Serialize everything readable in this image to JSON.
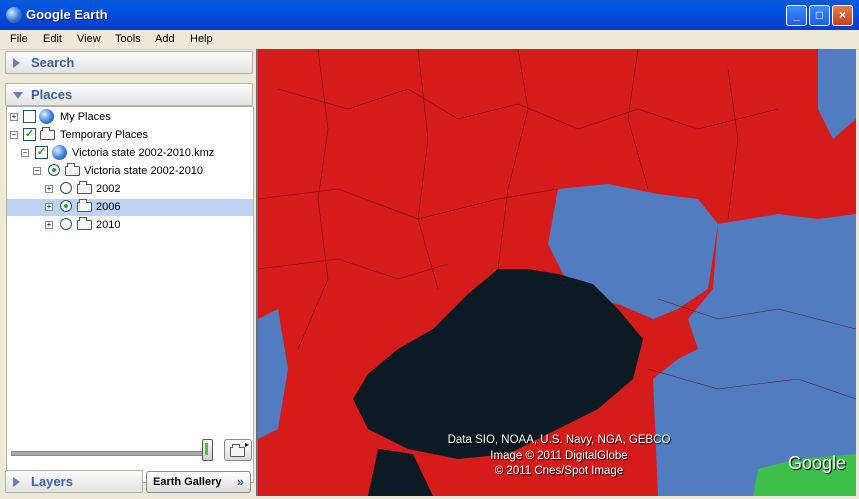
{
  "window": {
    "title": "Google Earth"
  },
  "menu": [
    "File",
    "Edit",
    "View",
    "Tools",
    "Add",
    "Help"
  ],
  "sidebar": {
    "search_label": "Search",
    "places_label": "Places",
    "layers_label": "Layers",
    "tree": {
      "my_places": "My Places",
      "temporary_places": "Temporary Places",
      "kmz": "Victoria state 2002-2010.kmz",
      "folder": "Victoria state 2002-2010",
      "years": [
        "2002",
        "2006",
        "2010"
      ]
    },
    "earth_gallery": "Earth Gallery"
  },
  "map": {
    "attribution": [
      "Data SIO, NOAA, U.S. Navy, NGA, GEBCO",
      "Image © 2011 DigitalGlobe",
      "© 2011 Cnes/Spot Image"
    ],
    "logo": "Google",
    "colors": {
      "red": "#d61b1b",
      "blue": "#4a82c8",
      "water": "#0c1a24"
    }
  }
}
